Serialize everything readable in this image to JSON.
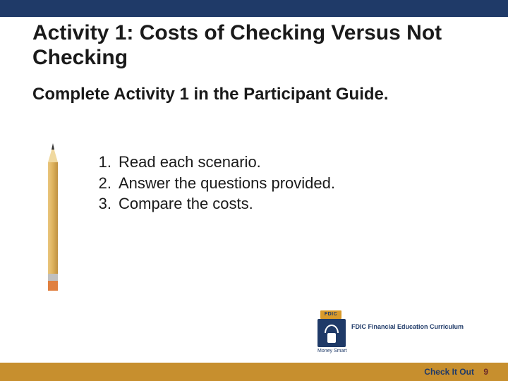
{
  "title": "Activity 1: Costs of Checking Versus Not Checking",
  "subtitle": "Complete Activity 1 in the Participant Guide.",
  "steps": [
    "Read each scenario.",
    "Answer the questions provided.",
    "Compare the costs."
  ],
  "logo": {
    "badge": "FDIC",
    "text": "FDIC Financial Education Curriculum",
    "caption": "Money Smart"
  },
  "footer": {
    "label": "Check It Out",
    "page": "9"
  },
  "colors": {
    "top_bar": "#1f3a68",
    "bottom_bar": "#c78f2e"
  }
}
